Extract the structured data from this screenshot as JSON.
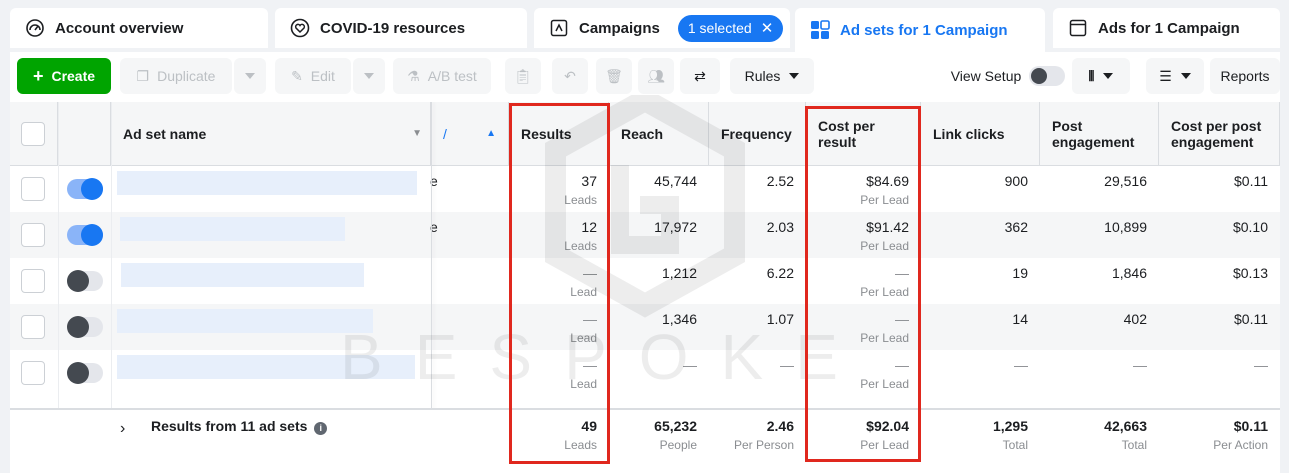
{
  "tabs": [
    {
      "label": "Account overview"
    },
    {
      "label": "COVID-19 resources"
    },
    {
      "label": "Campaigns",
      "pill": "1 selected"
    },
    {
      "label": "Ad sets for 1 Campaign"
    },
    {
      "label": "Ads for 1 Campaign"
    }
  ],
  "toolbar": {
    "create": "Create",
    "duplicate": "Duplicate",
    "edit": "Edit",
    "ab_test": "A/B test",
    "rules": "Rules",
    "view_setup": "View Setup",
    "reports": "Reports"
  },
  "columns": {
    "name": "Ad set name",
    "results": "Results",
    "reach": "Reach",
    "frequency": "Frequency",
    "cost_per_result": "Cost per result",
    "link_clicks": "Link clicks",
    "post_engagement": "Post engagement",
    "cost_per_post_engagement": "Cost per post engagement"
  },
  "rows": [
    {
      "on": true,
      "trunc": "e",
      "results": "37",
      "results_sub": "Leads",
      "reach": "45,744",
      "frequency": "2.52",
      "cpr": "$84.69",
      "cpr_sub": "Per Lead",
      "clicks": "900",
      "engagement": "29,516",
      "cpe": "$0.11"
    },
    {
      "on": true,
      "trunc": "e",
      "results": "12",
      "results_sub": "Leads",
      "reach": "17,972",
      "frequency": "2.03",
      "cpr": "$91.42",
      "cpr_sub": "Per Lead",
      "clicks": "362",
      "engagement": "10,899",
      "cpe": "$0.10"
    },
    {
      "on": false,
      "trunc": "",
      "results": "—",
      "results_sub": "Lead",
      "reach": "1,212",
      "frequency": "6.22",
      "cpr": "—",
      "cpr_sub": "Per Lead",
      "clicks": "19",
      "engagement": "1,846",
      "cpe": "$0.13"
    },
    {
      "on": false,
      "trunc": "",
      "results": "—",
      "results_sub": "Lead",
      "reach": "1,346",
      "frequency": "1.07",
      "cpr": "—",
      "cpr_sub": "Per Lead",
      "clicks": "14",
      "engagement": "402",
      "cpe": "$0.11"
    },
    {
      "on": false,
      "trunc": "",
      "results": "—",
      "results_sub": "Lead",
      "reach": "—",
      "frequency": "—",
      "cpr": "—",
      "cpr_sub": "Per Lead",
      "clicks": "—",
      "engagement": "—",
      "cpe": "—"
    }
  ],
  "totals": {
    "label": "Results from 11 ad sets",
    "results": "49",
    "results_sub": "Leads",
    "reach": "65,232",
    "reach_sub": "People",
    "frequency": "2.46",
    "frequency_sub": "Per Person",
    "cpr": "$92.04",
    "cpr_sub": "Per Lead",
    "clicks": "1,295",
    "clicks_sub": "Total",
    "engagement": "42,663",
    "engagement_sub": "Total",
    "cpe": "$0.11",
    "cpe_sub": "Per Action"
  },
  "watermark": "BESPOKE",
  "colors": {
    "accent": "#1877f2",
    "create": "#00a400",
    "highlight": "#e0281e"
  }
}
